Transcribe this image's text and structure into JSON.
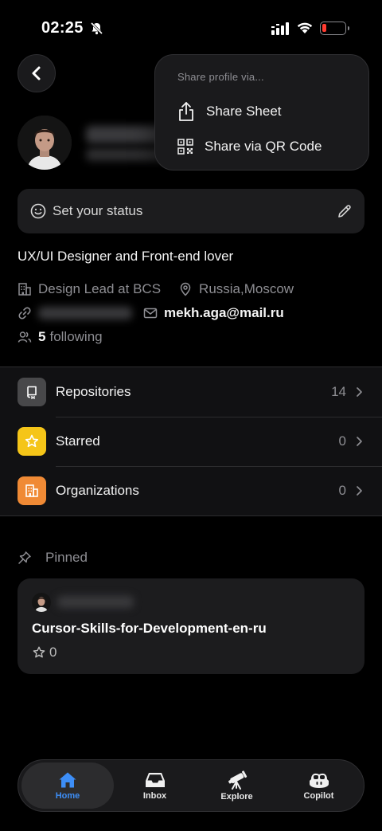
{
  "status_bar": {
    "time": "02:25"
  },
  "share_menu": {
    "title": "Share profile via...",
    "items": [
      {
        "label": "Share Sheet",
        "icon": "share-icon"
      },
      {
        "label": "Share via QR Code",
        "icon": "qr-code-icon"
      }
    ]
  },
  "profile": {
    "status_placeholder": "Set your status",
    "bio": "UX/UI Designer and Front-end lover",
    "company": "Design Lead at BCS",
    "location": "Russia,Moscow",
    "email": "mekh.aga@mail.ru",
    "following_count": "5",
    "following_label": "following"
  },
  "list": {
    "items": [
      {
        "label": "Repositories",
        "count": "14",
        "icon": "repo-icon",
        "color": "#48484a"
      },
      {
        "label": "Starred",
        "count": "0",
        "icon": "star-icon",
        "color": "#f5c518"
      },
      {
        "label": "Organizations",
        "count": "0",
        "icon": "organization-icon",
        "color": "#f08a35"
      }
    ]
  },
  "pinned": {
    "heading": "Pinned",
    "repo_name": "Cursor-Skills-for-Development-en-ru",
    "stars": "0"
  },
  "tabbar": {
    "tabs": [
      {
        "label": "Home",
        "active": true
      },
      {
        "label": "Inbox"
      },
      {
        "label": "Explore"
      },
      {
        "label": "Copilot"
      }
    ]
  },
  "colors": {
    "accent": "#3d8ef7",
    "background": "#000000",
    "surface": "#1c1c1e"
  }
}
